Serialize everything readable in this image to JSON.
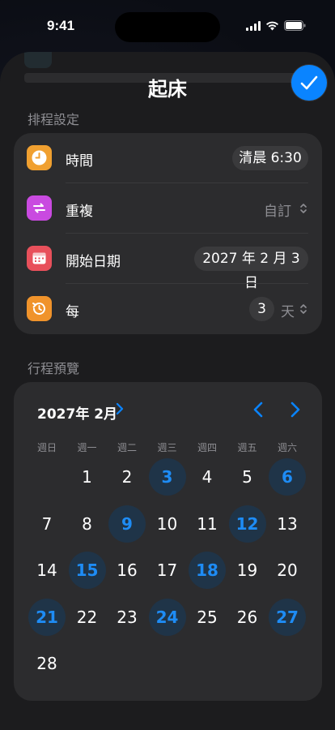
{
  "status_bar": {
    "time": "9:41"
  },
  "sheet": {
    "title": "起床"
  },
  "schedule": {
    "header": "排程設定",
    "rows": [
      {
        "label": "時間",
        "value": "清晨 6:30",
        "icon": "clock-icon",
        "icon_color": "#f0a030"
      },
      {
        "label": "重複",
        "value": "自訂",
        "icon": "repeat-icon",
        "icon_color": "#c94ae0"
      },
      {
        "label": "開始日期",
        "value": "2027 年 2 月 3 日",
        "icon": "calendar-icon",
        "icon_color": "#e8505b"
      },
      {
        "label": "每",
        "count": "3",
        "unit": "天",
        "icon": "history-icon",
        "icon_color": "#f0932b"
      }
    ]
  },
  "preview": {
    "header": "行程預覽",
    "month": "2027年 2月",
    "weekdays": [
      "週日",
      "週一",
      "週二",
      "週三",
      "週四",
      "週五",
      "週六"
    ],
    "first_weekday_index": 1,
    "days": [
      "1",
      "2",
      "3",
      "4",
      "5",
      "6",
      "7",
      "8",
      "9",
      "10",
      "11",
      "12",
      "13",
      "14",
      "15",
      "16",
      "17",
      "18",
      "19",
      "20",
      "21",
      "22",
      "23",
      "24",
      "25",
      "26",
      "27",
      "28"
    ],
    "highlighted": [
      "3",
      "6",
      "9",
      "12",
      "15",
      "18",
      "21",
      "24",
      "27"
    ]
  },
  "colors": {
    "accent": "#0a84ff",
    "highlight_text": "#1e8cf5",
    "highlight_bg": "#1f3448",
    "card": "#2c2c2e",
    "sheet": "#1c1c1e"
  }
}
